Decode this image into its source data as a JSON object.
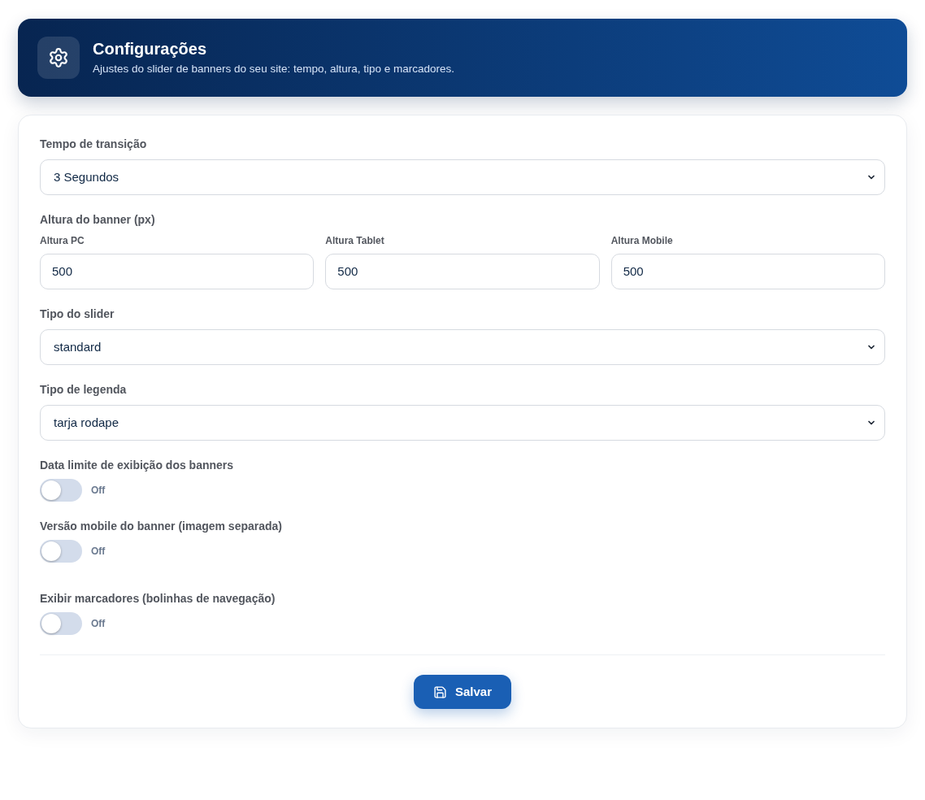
{
  "header": {
    "title": "Configurações",
    "subtitle": "Ajustes do slider de banners do seu site: tempo, altura, tipo e marcadores."
  },
  "fields": [
    {
      "kind": "select",
      "label": "Tempo de transição",
      "value": "3 Segundos"
    },
    {
      "kind": "group",
      "label": "Altura do banner (px)",
      "inputs": [
        {
          "label": "Altura PC",
          "value": "500"
        },
        {
          "label": "Altura Tablet",
          "value": "500"
        },
        {
          "label": "Altura Mobile",
          "value": "500"
        }
      ]
    },
    {
      "kind": "select",
      "label": "Tipo do slider",
      "value": "standard"
    },
    {
      "kind": "select",
      "label": "Tipo de legenda",
      "value": "tarja rodape"
    },
    {
      "kind": "toggle",
      "label": "Data limite de exibição dos banners",
      "on": false,
      "state_label": "Off"
    },
    {
      "kind": "toggle",
      "label": "Versão mobile do banner (imagem separada)",
      "on": false,
      "state_label": "Off"
    },
    {
      "kind": "toggle",
      "label": "Exibir marcadores (bolinhas de navegação)",
      "on": false,
      "state_label": "Off"
    }
  ],
  "save_button": {
    "label": "Salvar"
  }
}
